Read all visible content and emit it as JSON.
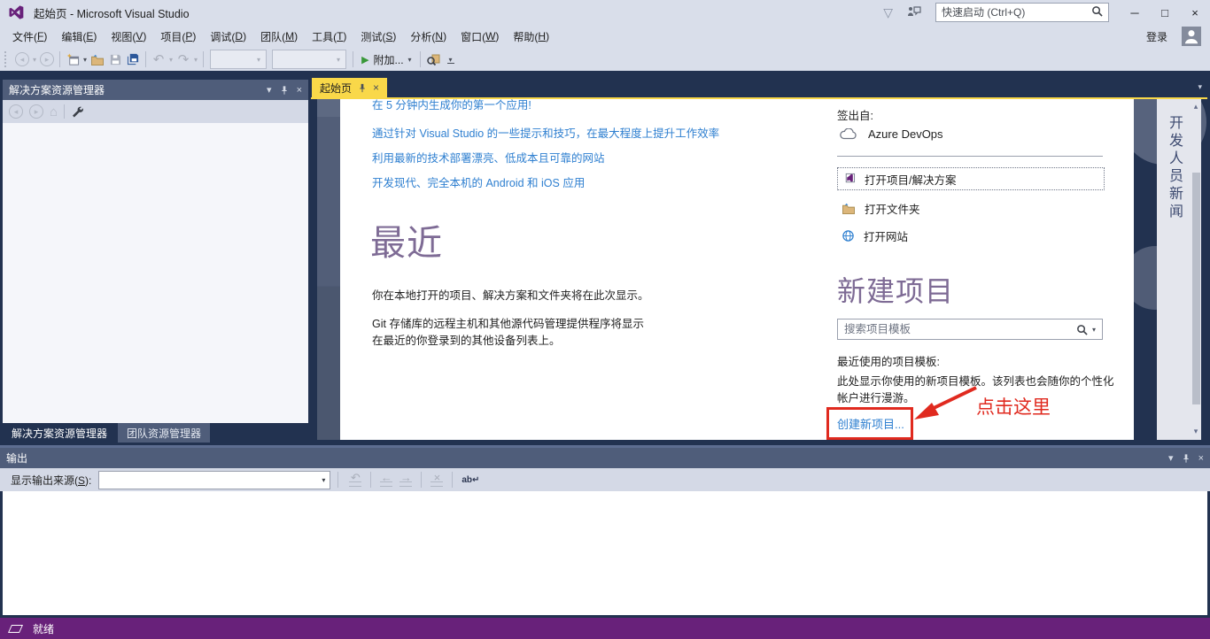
{
  "window": {
    "title": "起始页 - Microsoft Visual Studio"
  },
  "icons": {
    "chevron_down": "▾",
    "chevron_up": "▴",
    "close": "×",
    "minimize": "─",
    "maximize": "□",
    "filter": "▽",
    "play": "▶",
    "back": "◂",
    "forward": "▸",
    "home": "⌂",
    "undo": "↶",
    "redo": "↷",
    "nav_jump": "↶",
    "nav_prev": "←",
    "nav_next": "→",
    "clear": "×",
    "word_wrap": "ab↵"
  },
  "titlebar": {
    "quick_launch_placeholder": "快速启动 (Ctrl+Q)"
  },
  "menubar": {
    "items": [
      "文件(F)",
      "编辑(E)",
      "视图(V)",
      "项目(P)",
      "调试(D)",
      "团队(M)",
      "工具(T)",
      "测试(S)",
      "分析(N)",
      "窗口(W)",
      "帮助(H)"
    ],
    "sign_in": "登录"
  },
  "toolbar": {
    "attach_label": "附加..."
  },
  "solution_explorer": {
    "title": "解决方案资源管理器",
    "bottom_tabs": [
      "解决方案资源管理器",
      "团队资源管理器"
    ]
  },
  "start_page": {
    "tab_label": "起始页",
    "links": [
      "在 5 分钟内生成你的第一个应用!",
      "通过针对 Visual Studio 的一些提示和技巧，在最大程度上提升工作效率",
      "利用最新的技术部署漂亮、低成本且可靠的网站",
      "开发现代、完全本机的 Android 和 iOS 应用"
    ],
    "recent": {
      "heading": "最近",
      "line1": "你在本地打开的项目、解决方案和文件夹将在此次显示。",
      "line2a": "Git 存储库的远程主机和其他源代码管理提供程序将显示",
      "line2b": "在最近的你登录到的其他设备列表上。"
    },
    "open": {
      "checkout_label": "签出自:",
      "azure_devops": "Azure DevOps",
      "actions": [
        "打开项目/解决方案",
        "打开文件夹",
        "打开网站"
      ]
    },
    "new_project": {
      "heading": "新建项目",
      "search_placeholder": "搜索项目模板",
      "recent_label": "最近使用的项目模板:",
      "desc_line1": "此处显示你使用的新项目模板。该列表也会随你的个性化",
      "desc_line2": "帐户进行漫游。",
      "create_link": "创建新项目..."
    },
    "news_tab": "开发人员新闻"
  },
  "annotation": {
    "text": "点击这里"
  },
  "output": {
    "title": "输出",
    "source_label": "显示输出来源(S):"
  },
  "statusbar": {
    "ready": "就绪"
  },
  "colors": {
    "accent_purple": "#68217a",
    "active_tab_yellow": "#f9d849",
    "link_blue": "#2e7fd0",
    "heading_purple": "#7e6b95",
    "annotation_red": "#e02a1f",
    "panel_header_slate": "#4f5d7a",
    "chrome_bg": "#d9deea",
    "document_well_bg": "#223250",
    "statusbar_purple": "#68217a"
  }
}
